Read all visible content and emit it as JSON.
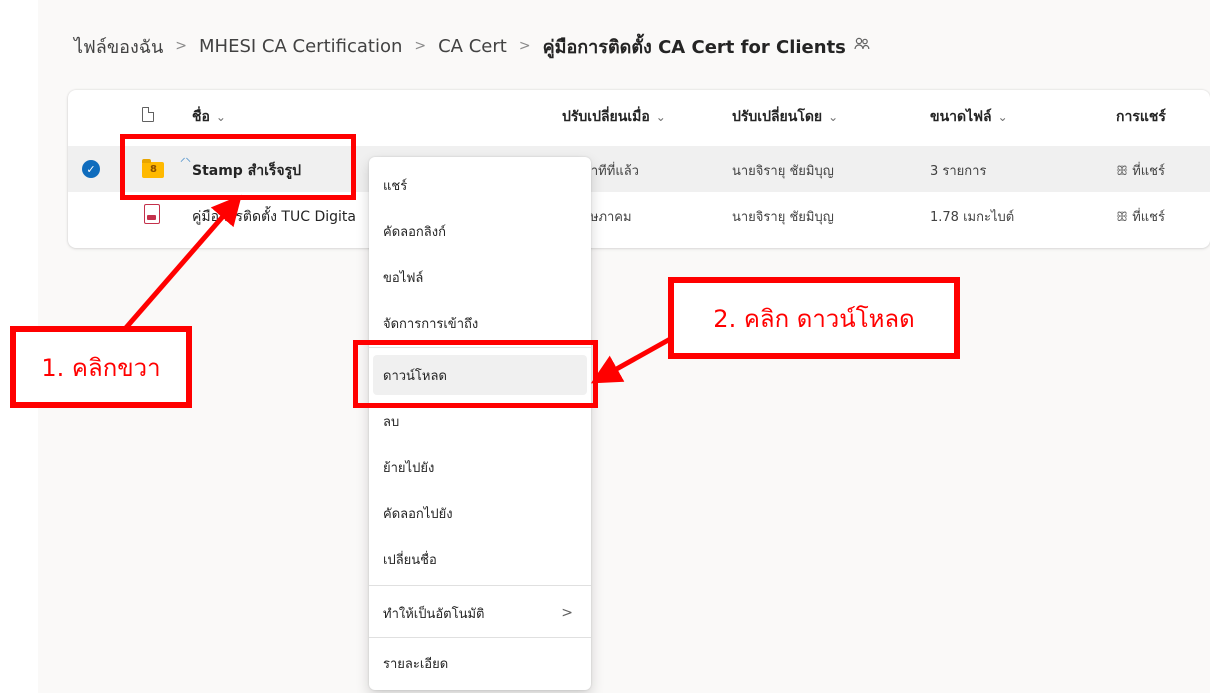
{
  "breadcrumb": {
    "items": [
      "ไฟล์ของฉัน",
      "MHESI CA Certification",
      "CA Cert"
    ],
    "current": "คู่มือการติดตั้ง CA Cert for Clients",
    "separator": ">",
    "share_icon": "people-icon"
  },
  "table": {
    "columns": {
      "type_icon": "file-icon",
      "name": "ชื่อ",
      "modified": "ปรับเปลี่ยนเมื่อ",
      "modified_by": "ปรับเปลี่ยนโดย",
      "size": "ขนาดไฟล์",
      "sharing": "การแชร์"
    },
    "chevron": "⌄",
    "rows": [
      {
        "selected": true,
        "icon": "shared-folder-icon",
        "name": "Stamp สำเร็จรูป",
        "modified": "นาทีที่แล้ว",
        "modified_by": "นายจิรายุ ชัยมิบุญ",
        "size": "3 รายการ",
        "sharing": "ที่แชร์"
      },
      {
        "selected": false,
        "icon": "pdf-icon",
        "name": "คู่มือการติดตั้ง TUC Digita",
        "modified": "ฤษภาคม",
        "modified_by": "นายจิรายุ ชัยมิบุญ",
        "size": "1.78 เมกะไบต์",
        "sharing": "ที่แชร์"
      }
    ]
  },
  "context_menu": {
    "items": [
      "แชร์",
      "คัดลอกลิงก์",
      "ขอไฟล์",
      "จัดการการเข้าถึง",
      "ดาวน์โหลด",
      "ลบ",
      "ย้ายไปยัง",
      "คัดลอกไปยัง",
      "เปลี่ยนชื่อ",
      "ทำให้เป็นอัตโนมัติ",
      "รายละเอียด"
    ],
    "highlighted": "ดาวน์โหลด",
    "submenu_arrow": ">"
  },
  "annotations": {
    "step1": "1. คลิกขวา",
    "step2": "2. คลิก ดาวน์โหลด",
    "color": "#ff0000"
  },
  "colors": {
    "accent": "#0f6cbd",
    "folder": "#ffb900",
    "pdf": "#c4314b"
  }
}
